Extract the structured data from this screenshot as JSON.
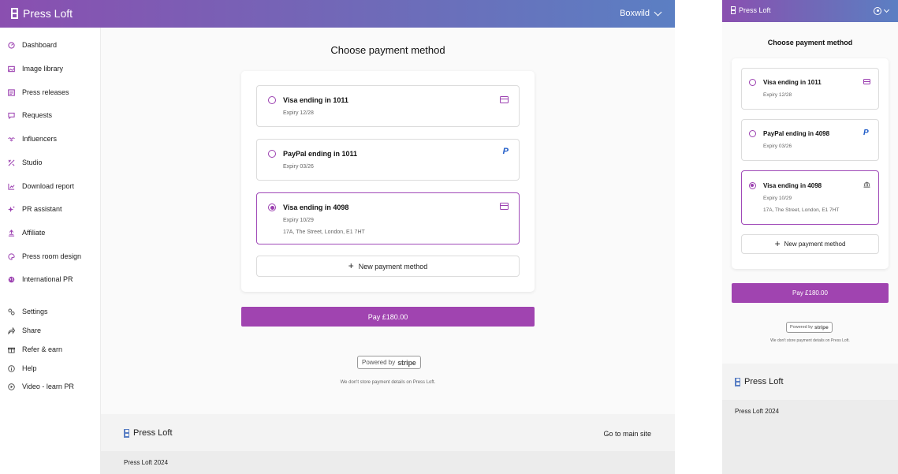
{
  "brand": {
    "name": "Press Loft"
  },
  "header": {
    "account_name": "Boxwild"
  },
  "sidebar": {
    "items": [
      {
        "label": "Dashboard",
        "icon": "dashboard-icon"
      },
      {
        "label": "Image library",
        "icon": "image-icon"
      },
      {
        "label": "Press releases",
        "icon": "newspaper-icon"
      },
      {
        "label": "Requests",
        "icon": "chat-icon"
      },
      {
        "label": "Influencers",
        "icon": "handshake-icon"
      },
      {
        "label": "Studio",
        "icon": "studio-icon"
      },
      {
        "label": "Download report",
        "icon": "chart-icon"
      },
      {
        "label": "PR assistant",
        "icon": "sparkle-icon"
      },
      {
        "label": "Affiliate",
        "icon": "affiliate-icon"
      },
      {
        "label": "Press room design",
        "icon": "palette-icon"
      },
      {
        "label": "International PR",
        "icon": "globe-icon"
      }
    ],
    "secondary": [
      {
        "label": "Settings",
        "icon": "settings-icon"
      },
      {
        "label": "Share",
        "icon": "share-icon"
      },
      {
        "label": "Refer & earn",
        "icon": "gift-icon"
      },
      {
        "label": "Help",
        "icon": "info-icon"
      },
      {
        "label": "Video - learn PR",
        "icon": "play-icon"
      }
    ]
  },
  "checkout": {
    "title": "Choose payment method",
    "methods": [
      {
        "title": "Visa ending in 1011",
        "expiry": "Expiry 12/28",
        "icon": "credit-card-icon",
        "selected": false
      },
      {
        "title": "PayPal ending in 1011",
        "expiry": "Expiry 03/26",
        "icon": "paypal-icon",
        "selected": false
      },
      {
        "title": "Visa ending in 4098",
        "expiry": "Expiry 10/29",
        "address": "17A, The Street, London, E1 7HT",
        "icon": "credit-card-icon",
        "selected": true
      }
    ],
    "new_method_label": "New payment method",
    "pay_label": "Pay £180.00",
    "powered_by": "Powered by",
    "stripe": "stripe",
    "disclaimer": "We don't store payment details on Press Loft."
  },
  "mobile": {
    "title": "Choose payment method",
    "methods": [
      {
        "title": "Visa ending in 1011",
        "expiry": "Expiry 12/28",
        "icon": "credit-card-icon",
        "selected": false
      },
      {
        "title": "PayPal ending in 4098",
        "expiry": "Expiry 03/26",
        "icon": "paypal-icon",
        "selected": false
      },
      {
        "title": "Visa ending in 4098",
        "expiry": "Expiry 10/29",
        "address": "17A, The Street, London, E1 7HT",
        "icon": "bank-icon",
        "selected": true
      }
    ],
    "new_method_label": "New payment method",
    "pay_label": "Pay £180.00",
    "powered_by": "Powered by",
    "stripe": "stripe",
    "disclaimer": "We don't store payment details on Press Loft."
  },
  "footer": {
    "brand": "Press Loft",
    "link": "Go to main site",
    "copyright": "Press Loft 2024"
  },
  "colors": {
    "accent": "#a044b0",
    "header_start": "#8a4fb0",
    "header_end": "#5b7fc3",
    "paypal": "#1f5cc8"
  }
}
